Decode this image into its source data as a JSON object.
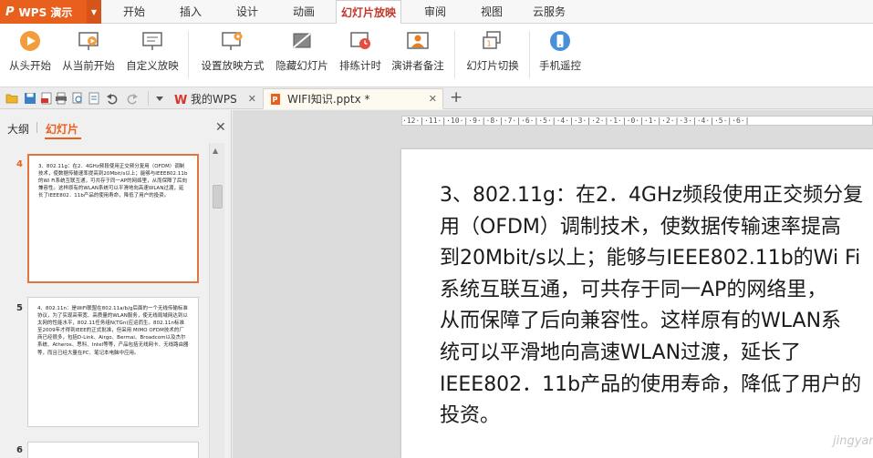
{
  "app": {
    "name": "WPS 演示",
    "logo": "P"
  },
  "menu_tabs": [
    {
      "label": "开始"
    },
    {
      "label": "插入"
    },
    {
      "label": "设计"
    },
    {
      "label": "动画"
    },
    {
      "label": "幻灯片放映",
      "active": true
    },
    {
      "label": "审阅"
    },
    {
      "label": "视图"
    },
    {
      "label": "云服务"
    }
  ],
  "ribbon": {
    "from_start": "从头开始",
    "from_current": "从当前开始",
    "custom_show": "自定义放映",
    "setup_show": "设置放映方式",
    "hide_slide": "隐藏幻灯片",
    "rehearse": "排练计时",
    "presenter_notes": "演讲者备注",
    "slide_switch": "幻灯片切换",
    "remote_control": "手机遥控"
  },
  "doc_tabs": {
    "my_wps": "我的WPS",
    "current_file": "WIFI知识.pptx *"
  },
  "panel": {
    "outline_tab": "大纲",
    "slides_tab": "幻灯片"
  },
  "slides": [
    {
      "number": "4",
      "text": "3、802.11g：在2．4GHz频段使用正交频分复用（OFDM）调制技术，使数据传输速率提高到20Mbit/s以上；能够与IEEE802.11b的Wi Fi系统互联互通，可共存于同一AP的网络里，从而保障了后向兼容性。这样原有的WLAN系统可以平滑地向高速WLAN过渡，延长了IEEE802．11b产品的使用寿命，降低了用户的投资。"
    },
    {
      "number": "5",
      "text": "4、802.11n：是WiFi联盟在802.11a/b/g后面的一个无线传输标准协议，为了实现高带宽、高质量的WLAN服务，使无线局域网达到以太网的性能水平，802.11任务组N(TGn)应运而生。802.11n标准至2009年才得到IEEE的正式批准，但采用 MIMO OFDM技术的厂商已经很多，包括D-Link、Airgo、Bermai、Broadcom以及杰尔系统、Atheros、思科、Intel等等，产品包括无线网卡、无线路由器等，而且已经大量在PC、笔记本电脑中应用。"
    },
    {
      "number": "6",
      "text": ""
    }
  ],
  "main_slide": {
    "lines": [
      "3、802.11g：在2．4GHz频段使用正交频分复",
      "用（OFDM）调制技术，使数据传输速率提高",
      "到20Mbit/s以上；能够与IEEE802.11b的Wi Fi",
      "系统互联互通，可共存于同一AP的网络里，",
      "从而保障了后向兼容性。这样原有的WLAN系",
      "统可以平滑地向高速WLAN过渡，延长了",
      "IEEE802．11b产品的使用寿命，降低了用户的",
      "投资。"
    ]
  },
  "ruler": {
    "text": "·12·|·11·|·10·|·9·|·8·|·7·|·6·|·5·|·4·|·3·|·2·|·1·|·0·|·1·|·2·|·3·|·4·|·5·|·6·|"
  },
  "watermark": "jingyan.baidu.com",
  "colors": {
    "accent": "#e8601c",
    "active_tab_text": "#c0392b"
  }
}
